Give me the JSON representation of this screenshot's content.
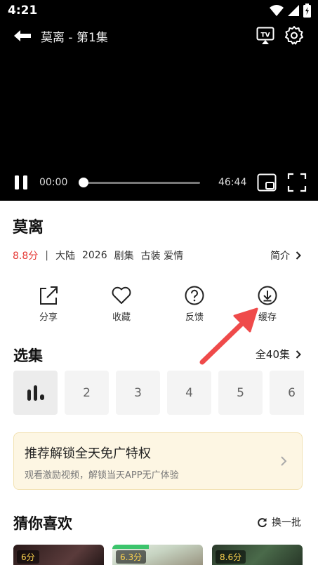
{
  "status_bar": {
    "time": "4:21"
  },
  "player": {
    "title": "莫离 - 第1集",
    "time_current": "00:00",
    "time_total": "46:44",
    "progress": 0
  },
  "show": {
    "title": "莫离",
    "score": "8.8分",
    "separator": "|",
    "region": "大陆",
    "year": "2026",
    "type": "剧集",
    "genres": "古装 爱情",
    "intro_label": "简介"
  },
  "actions": [
    {
      "label": "分享",
      "icon": "share-icon"
    },
    {
      "label": "收藏",
      "icon": "heart-icon"
    },
    {
      "label": "反馈",
      "icon": "help-circle-icon"
    },
    {
      "label": "缓存",
      "icon": "download-circle-icon"
    }
  ],
  "episodes": {
    "title": "选集",
    "all_label": "全40集",
    "items": [
      "",
      "2",
      "3",
      "4",
      "5",
      "6"
    ],
    "current_index": 0
  },
  "promo": {
    "title": "推荐解锁全天免广特权",
    "subtitle": "观看激励视频，解锁当天APP无广体验"
  },
  "recommend": {
    "title": "猜你喜欢",
    "refresh_label": "换一批",
    "items": [
      {
        "score": "6分"
      },
      {
        "score": "6.3分"
      },
      {
        "score": "8.6分"
      }
    ]
  },
  "colors": {
    "score": "#e53935",
    "annotation_arrow": "#ef4a4a",
    "promo_bg": "#fdf6e3"
  }
}
